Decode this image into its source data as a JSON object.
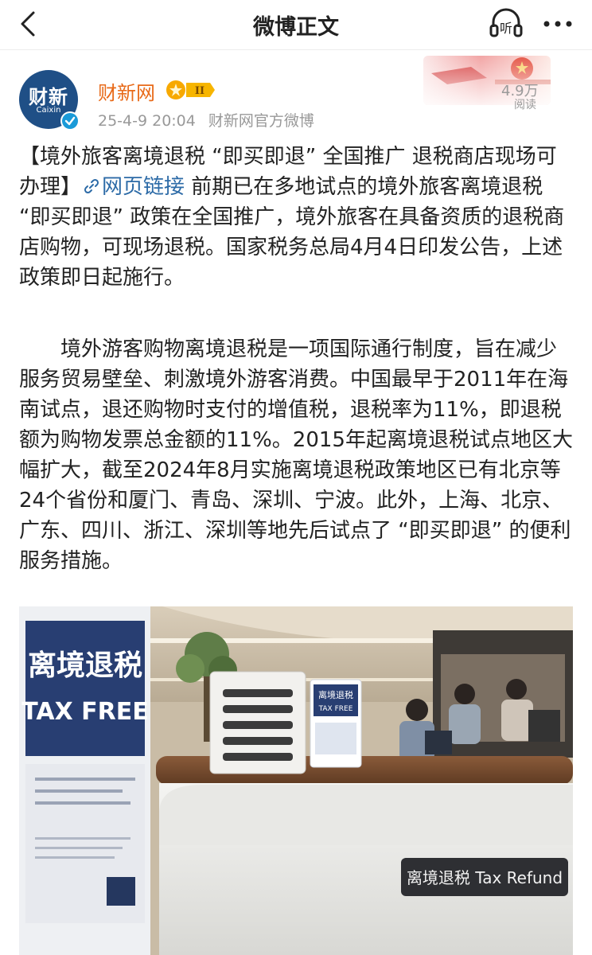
{
  "header": {
    "title": "微博正文",
    "listen_label": "听"
  },
  "author": {
    "name": "财新网",
    "avatar_text": "财新",
    "avatar_subtext": "Caixin",
    "badge_level": "II",
    "timestamp": "25-4-9 20:04",
    "source": "财新网官方微博",
    "reads_count": "4.9万",
    "reads_label": "阅读"
  },
  "post": {
    "headline": "【境外旅客离境退税 “即买即退” 全国推广 退税商店现场可办理】",
    "link_label": "网页链接",
    "body_1": " 前期已在多地试点的境外旅客离境退税 “即买即退” 政策在全国推广，境外旅客在具备资质的退税商店购物，可现场退税。国家税务总局4月4日印发公告，上述政策即日起施行。",
    "body_2": "境外游客购物离境退税是一项国际通行制度，旨在减少服务贸易壁垒、刺激境外游客消费。中国最早于2011年在海南试点，退还购物时支付的增值税，退税率为11%，即退税额为购物发票总金额的11%。2015年起离境退税试点地区大幅扩大，截至2024年8月实施离境退税政策地区已有北京等24个省份和厦门、青岛、深圳、宁波。此外，上海、北京、广东、四川、浙江、深圳等地先后试点了 “即买即退” 的便利服务措施。"
  },
  "photo": {
    "sign_cn": "离境退税",
    "sign_en": "TAX FREE",
    "counter_sign": "离境退税 Tax Refund",
    "small_sign_cn": "离境退税",
    "small_sign_en": "TAX FREE"
  },
  "colors": {
    "author_name": "#e86a19",
    "link": "#2d6ba7",
    "meta": "#999999",
    "avatar_bg": "#1f4f86",
    "verified": "#1a9ad8"
  }
}
